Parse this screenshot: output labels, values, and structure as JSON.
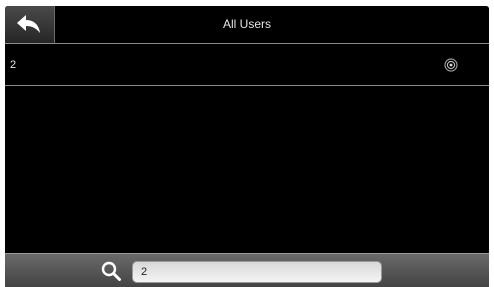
{
  "header": {
    "title": "All Users"
  },
  "users": [
    {
      "id": "2"
    }
  ],
  "search": {
    "value": "2"
  },
  "icons": {
    "back": "back-arrow-icon",
    "fingerprint": "fingerprint-icon",
    "search": "search-icon"
  }
}
